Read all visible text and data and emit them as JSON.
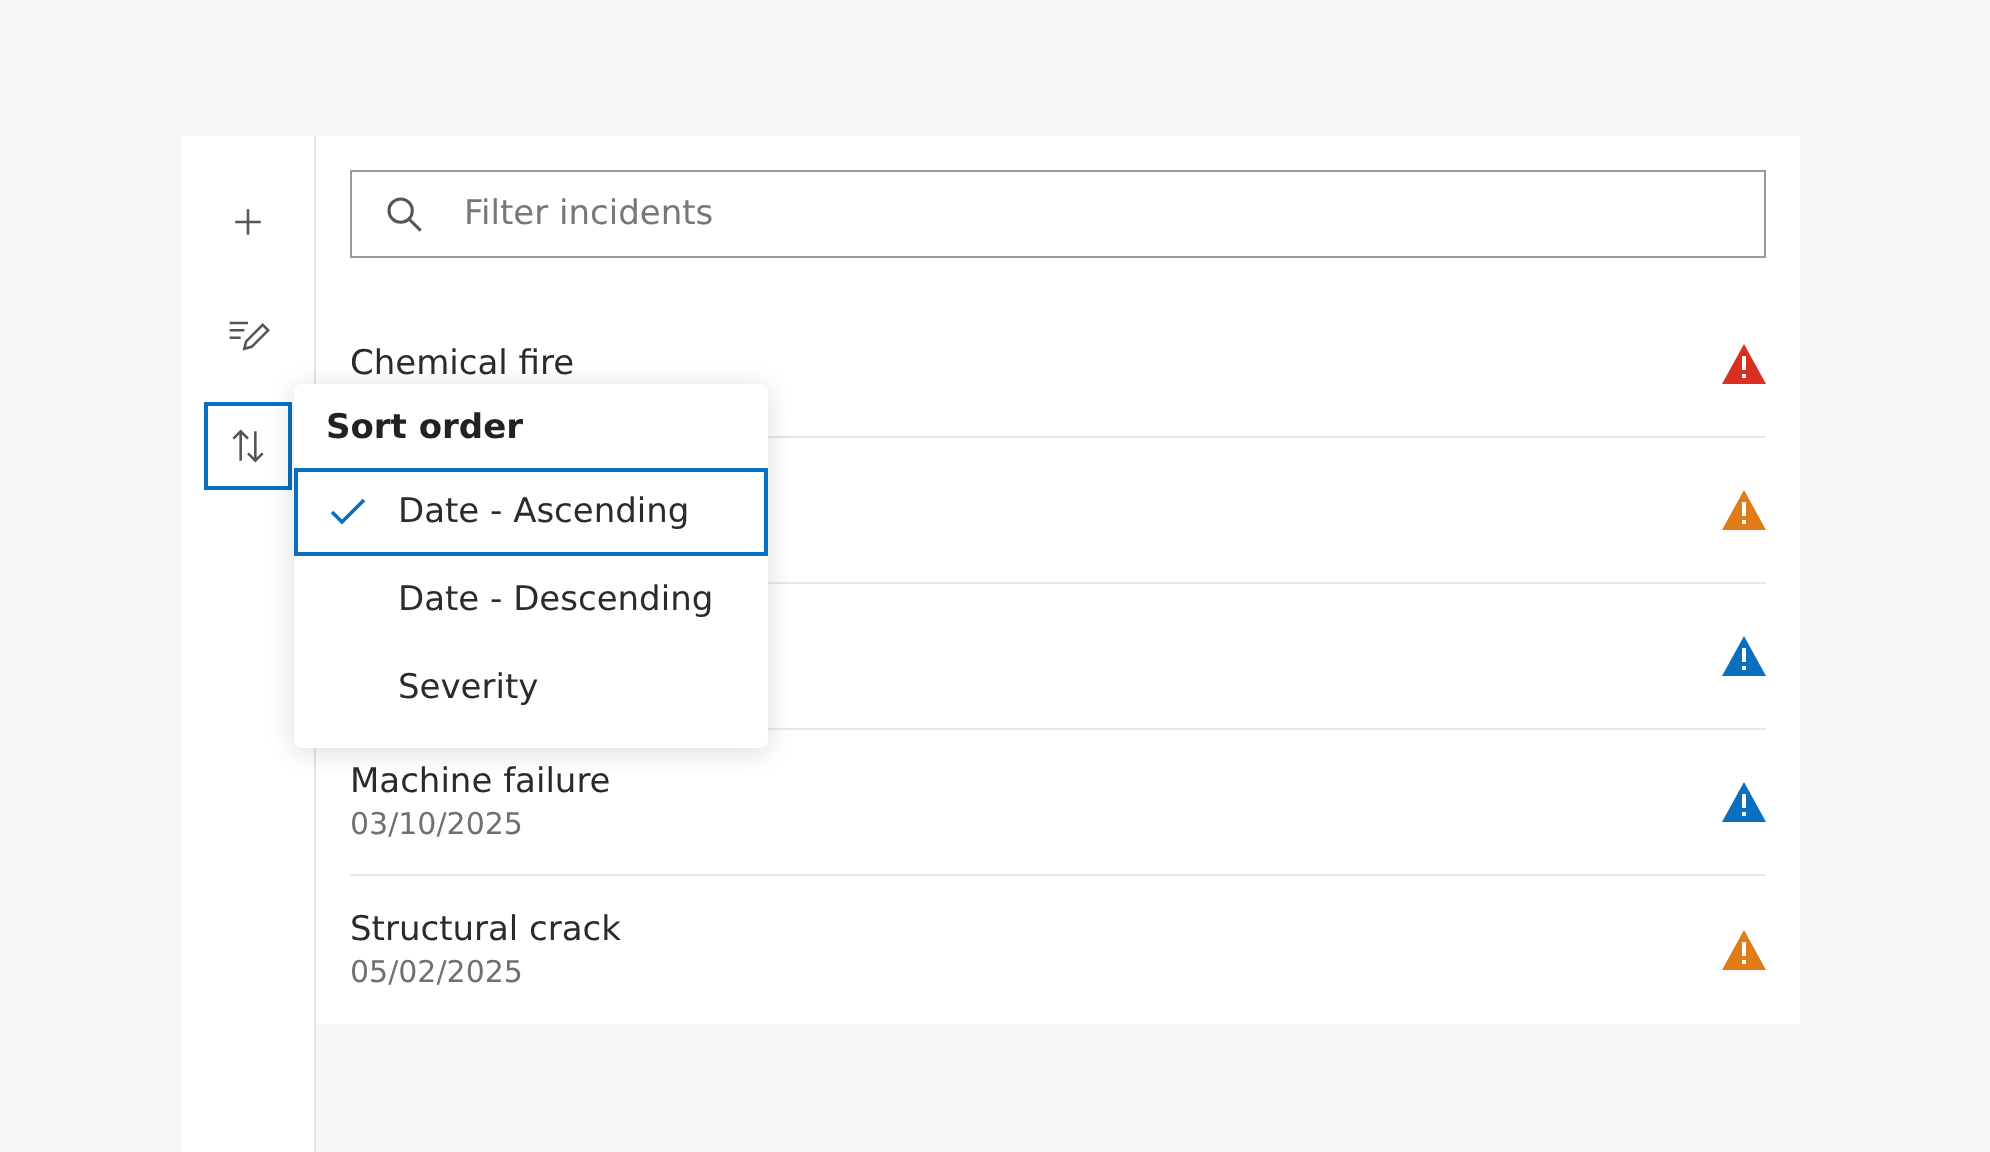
{
  "toolbar": [
    {
      "kind": "add",
      "active": false
    },
    {
      "kind": "edit",
      "active": false
    },
    {
      "kind": "sort",
      "active": true
    }
  ],
  "search": {
    "placeholder": "Filter incidents"
  },
  "incidents": [
    {
      "title": "Chemical fire",
      "color": "#d83020"
    },
    {
      "color": "#e07b1a"
    },
    {
      "color": "#0a6fbf"
    },
    {
      "title": "Machine failure",
      "date": "03/10/2025",
      "color": "#0a6fbf"
    },
    {
      "title": "Structural crack",
      "date": "05/02/2025",
      "color": "#e07b1a"
    }
  ],
  "sort_menu": {
    "title": "Sort order",
    "options": [
      {
        "label": "Date - Ascending",
        "selected": true
      },
      {
        "label": "Date - Descending",
        "selected": false
      },
      {
        "label": "Severity",
        "selected": false
      }
    ]
  }
}
